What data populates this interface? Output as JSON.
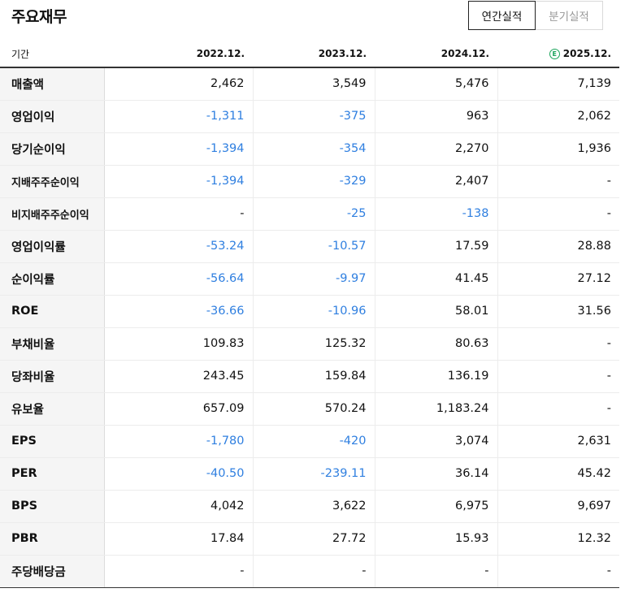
{
  "title": "주요재무",
  "tabs": [
    {
      "label": "연간실적",
      "active": true
    },
    {
      "label": "분기실적",
      "active": false
    }
  ],
  "estimate_badge": "E",
  "table": {
    "period_label": "기간",
    "columns": [
      "2022.12.",
      "2023.12.",
      "2024.12.",
      "2025.12."
    ],
    "rows": [
      {
        "label": "매출액",
        "values": [
          "2,462",
          "3,549",
          "5,476",
          "7,139"
        ]
      },
      {
        "label": "영업이익",
        "values": [
          "-1,311",
          "-375",
          "963",
          "2,062"
        ]
      },
      {
        "label": "당기순이익",
        "values": [
          "-1,394",
          "-354",
          "2,270",
          "1,936"
        ]
      },
      {
        "label": "지배주주순이익",
        "values": [
          "-1,394",
          "-329",
          "2,407",
          "-"
        ]
      },
      {
        "label": "비지배주주순이익",
        "values": [
          "-",
          "-25",
          "-138",
          "-"
        ]
      },
      {
        "label": "영업이익률",
        "values": [
          "-53.24",
          "-10.57",
          "17.59",
          "28.88"
        ]
      },
      {
        "label": "순이익률",
        "values": [
          "-56.64",
          "-9.97",
          "41.45",
          "27.12"
        ]
      },
      {
        "label": "ROE",
        "values": [
          "-36.66",
          "-10.96",
          "58.01",
          "31.56"
        ]
      },
      {
        "label": "부채비율",
        "values": [
          "109.83",
          "125.32",
          "80.63",
          "-"
        ]
      },
      {
        "label": "당좌비율",
        "values": [
          "243.45",
          "159.84",
          "136.19",
          "-"
        ]
      },
      {
        "label": "유보율",
        "values": [
          "657.09",
          "570.24",
          "1,183.24",
          "-"
        ]
      },
      {
        "label": "EPS",
        "values": [
          "-1,780",
          "-420",
          "3,074",
          "2,631"
        ]
      },
      {
        "label": "PER",
        "values": [
          "-40.50",
          "-239.11",
          "36.14",
          "45.42"
        ]
      },
      {
        "label": "BPS",
        "values": [
          "4,042",
          "3,622",
          "6,975",
          "9,697"
        ]
      },
      {
        "label": "PBR",
        "values": [
          "17.84",
          "27.72",
          "15.93",
          "12.32"
        ]
      },
      {
        "label": "주당배당금",
        "values": [
          "-",
          "-",
          "-",
          "-"
        ]
      }
    ]
  },
  "colors": {
    "negative": "#2f7fe0",
    "estimate": "#1aa35a"
  }
}
